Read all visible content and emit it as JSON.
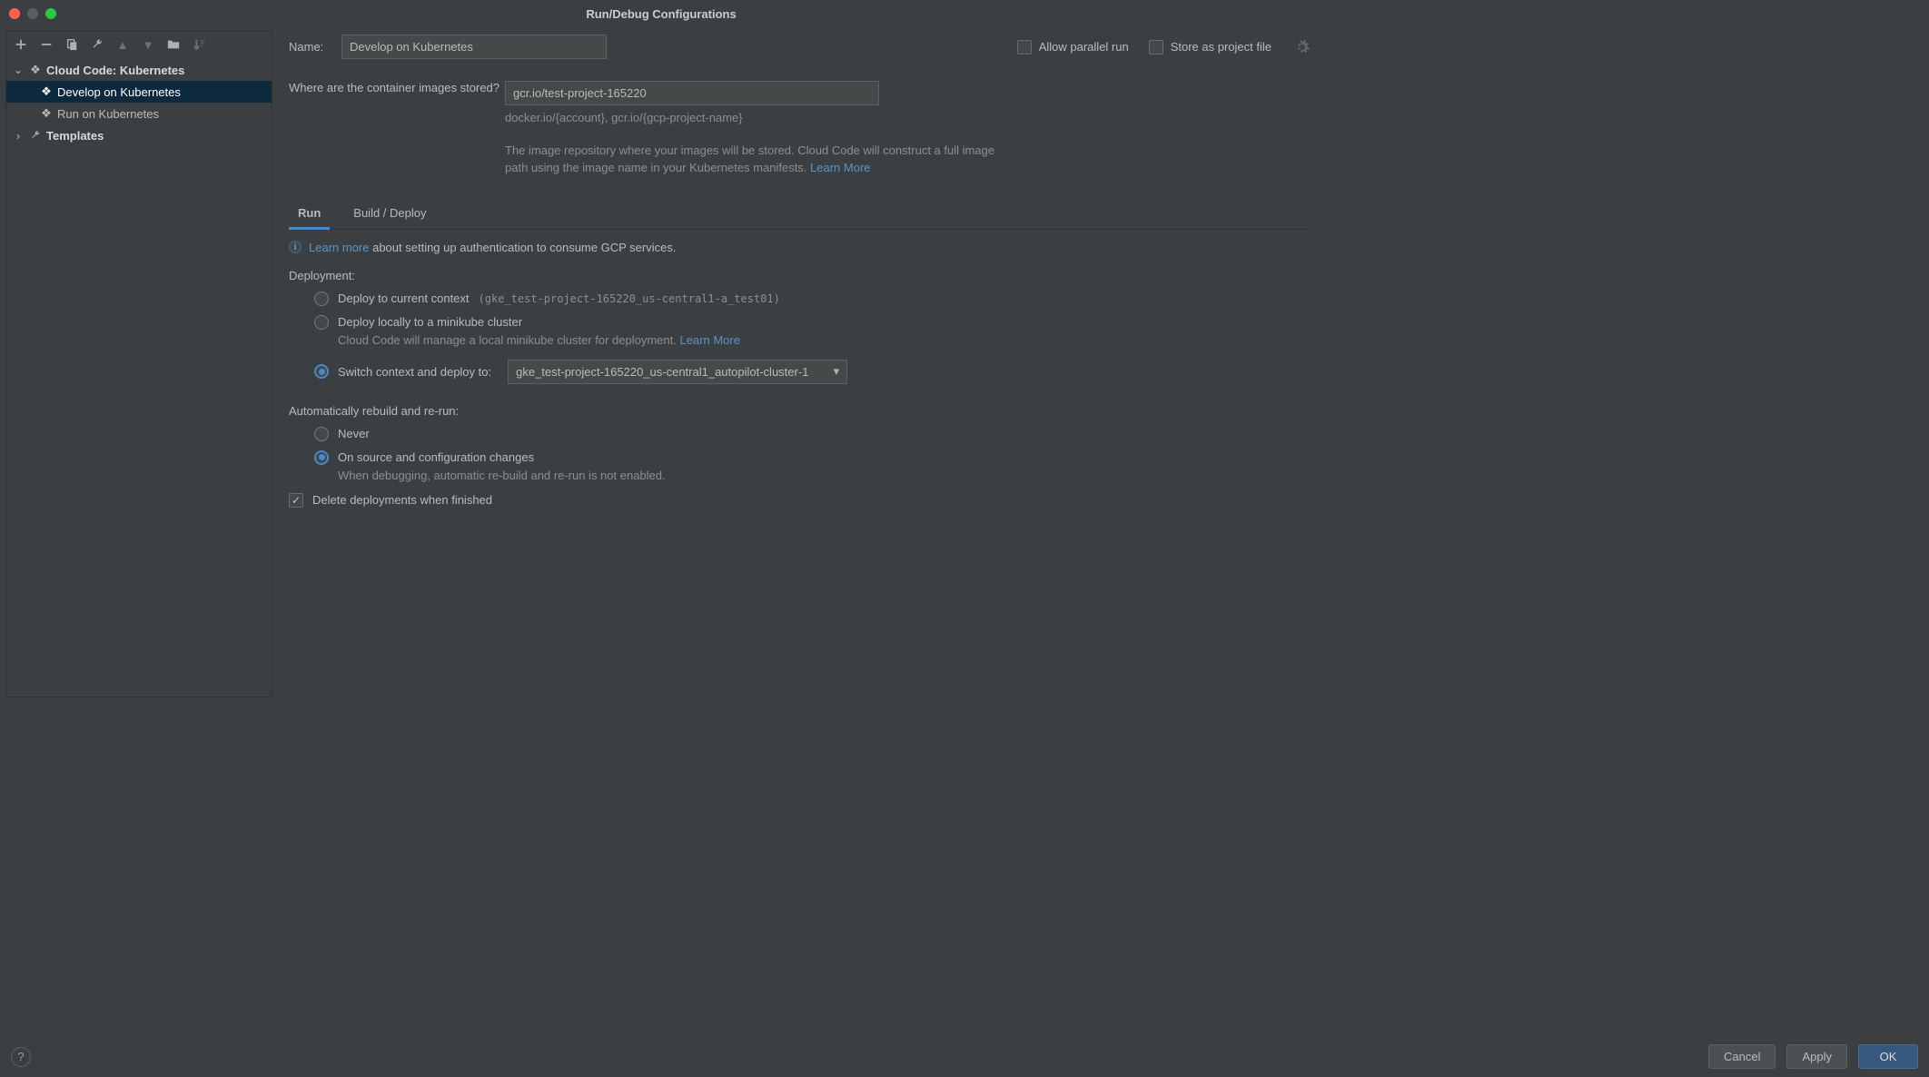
{
  "title": "Run/Debug Configurations",
  "nameLabel": "Name:",
  "nameValue": "Develop on Kubernetes",
  "allowParallel": {
    "label": "Allow parallel run",
    "checked": false
  },
  "storeAsProject": {
    "label": "Store as project file",
    "checked": false
  },
  "tree": {
    "cloudCode": {
      "label": "Cloud Code: Kubernetes"
    },
    "develop": {
      "label": "Develop on Kubernetes"
    },
    "run": {
      "label": "Run on Kubernetes"
    },
    "templates": {
      "label": "Templates"
    }
  },
  "imageQuestion": "Where are the container images stored?",
  "imageValue": "gcr.io/test-project-165220",
  "imageHint": "docker.io/{account}, gcr.io/{gcp-project-name}",
  "imageHelp": "The image repository where your images will be stored. Cloud Code will construct a full image path using the image name in your Kubernetes manifests. ",
  "learnMore": "Learn More",
  "learnMoreLower": "Learn more",
  "tabs": {
    "run": "Run",
    "build": "Build / Deploy"
  },
  "authHelp": " about setting up authentication to consume GCP services.",
  "deploymentHead": "Deployment:",
  "deployCurrent": "Deploy to current context",
  "deployCurrentDetail": "(gke_test-project-165220_us-central1-a_test01)",
  "deployMinikube": "Deploy locally to a minikube cluster",
  "deployMinikubeHelp": "Cloud Code will manage a local minikube cluster for deployment. ",
  "deploySwitch": "Switch context and deploy to:",
  "deploySwitchValue": "gke_test-project-165220_us-central1_autopilot-cluster-1",
  "rebuildHead": "Automatically rebuild and re-run:",
  "rebuildNever": "Never",
  "rebuildOnChange": "On source and configuration changes",
  "rebuildOnChangeHelp": "When debugging, automatic re-build and re-run is not enabled.",
  "deleteDeploy": {
    "label": "Delete deployments when finished",
    "checked": true
  },
  "buttons": {
    "cancel": "Cancel",
    "apply": "Apply",
    "ok": "OK"
  }
}
